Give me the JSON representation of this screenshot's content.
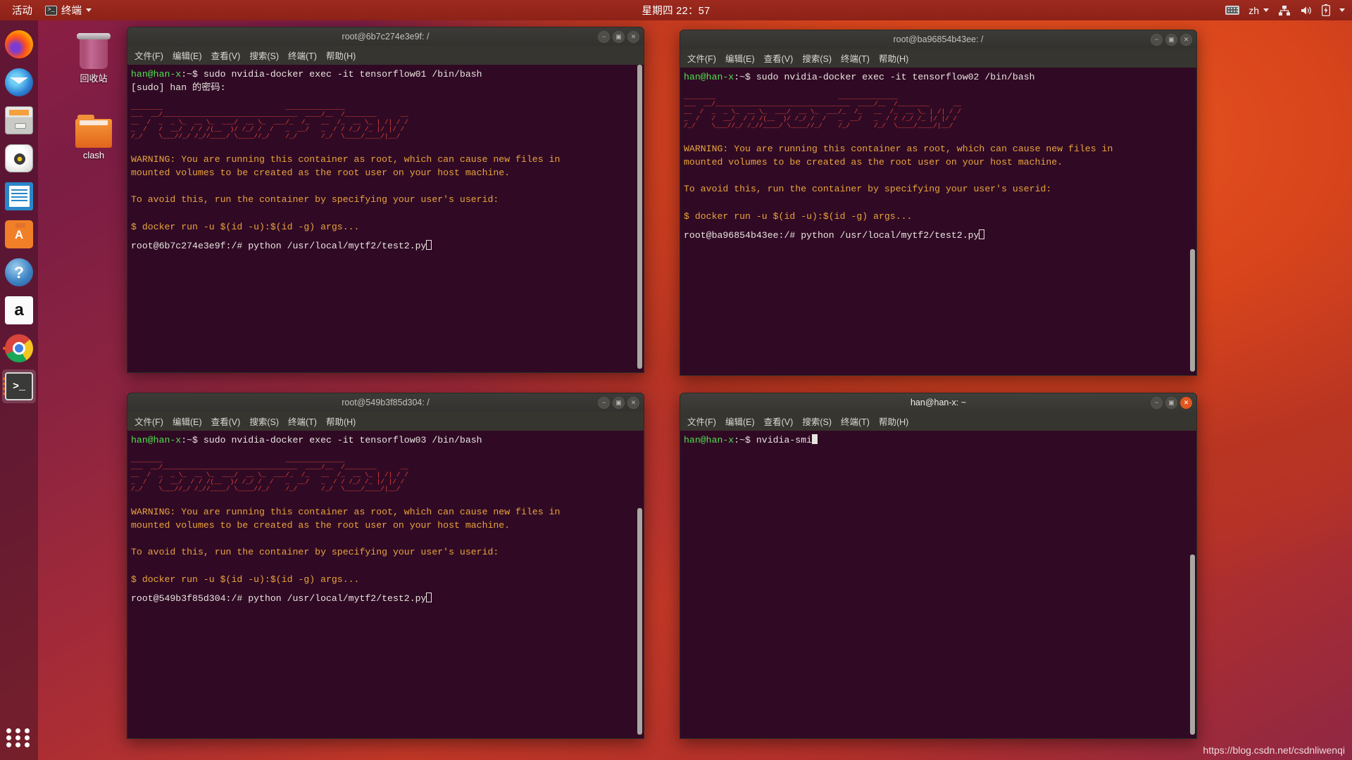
{
  "topbar": {
    "activities": "活动",
    "app_name": "终端",
    "app_icon": "terminal-icon",
    "clock": "星期四 22：57",
    "tray": {
      "keyboard_icon": "keyboard-icon",
      "input_language": "zh",
      "network_icon": "network-icon",
      "volume_icon": "volume-icon",
      "battery_icon": "battery-icon",
      "dropdown_icon": "chevron-down-icon"
    }
  },
  "dock": {
    "items": [
      {
        "name": "firefox",
        "icon": "firefox-icon",
        "glyph": "",
        "running": false
      },
      {
        "name": "thunderbird",
        "icon": "thunderbird-icon",
        "glyph": "",
        "running": false
      },
      {
        "name": "files",
        "icon": "files-icon",
        "glyph": "",
        "running": false
      },
      {
        "name": "rhythmbox",
        "icon": "rhythmbox-icon",
        "glyph": "",
        "running": false
      },
      {
        "name": "libreoffice-writer",
        "icon": "writer-icon",
        "glyph": "",
        "running": false
      },
      {
        "name": "ubuntu-software",
        "icon": "software-icon",
        "glyph": "",
        "running": false
      },
      {
        "name": "help",
        "icon": "help-icon",
        "glyph": "?",
        "running": false
      },
      {
        "name": "amazon",
        "icon": "amazon-icon",
        "glyph": "a",
        "running": false
      },
      {
        "name": "chrome",
        "icon": "chrome-icon",
        "glyph": "",
        "running": true
      },
      {
        "name": "terminal",
        "icon": "terminal-icon",
        "glyph": ">_",
        "running": true
      }
    ],
    "show_apps_label": "显示应用程序"
  },
  "desktop_icons": [
    {
      "label": "回收站",
      "icon": "trash-icon"
    },
    {
      "label": "clash",
      "icon": "folder-icon"
    }
  ],
  "menu": {
    "file": "文件(F)",
    "edit": "编辑(E)",
    "view": "查看(V)",
    "search": "搜索(S)",
    "terminal": "终端(T)",
    "help": "帮助(H)"
  },
  "window_buttons": {
    "minimize": "−",
    "maximize": "▣",
    "close": "✕"
  },
  "ascii_banner": [
    "________                               _______________",
    "___  __/__________________________________  ____/__  /________      __",
    "__  /  _  _ \\_  __ \\_  ___/  __ \\_  ___/_  /_   __  /_  __ \\_ | /| / /",
    "_  /   /  __/  / / /(__  )/ /_/ /  /   _  __/   _  / / /_/ /_ |/ |/ /",
    "/_/    \\___//_/ /_//____/ \\____//_/    /_/      /_/  \\____/____/|__/"
  ],
  "warning_lines": [
    "WARNING: You are running this container as root, which can cause new files in",
    "mounted volumes to be created as the root user on your host machine.",
    "",
    "To avoid this, run the container by specifying your user's userid:",
    "",
    "$ docker run -u $(id -u):$(id -g) args..."
  ],
  "windows": [
    {
      "id": "win-tensorflow01",
      "title": "root@6b7c274e3e9f: /",
      "focused": false,
      "prompt_user": "han@han-x",
      "prompt_path": ":~$ ",
      "command": "sudo nvidia-docker exec -it tensorflow01 /bin/bash",
      "sudo_line": "[sudo] han 的密码:",
      "root_prompt": "root@6b7c274e3e9f:/# ",
      "root_command": "python /usr/local/mytf2/test2.py",
      "show_banner": true
    },
    {
      "id": "win-tensorflow02",
      "title": "root@ba96854b43ee: /",
      "focused": false,
      "prompt_user": "han@han-x",
      "prompt_path": ":~$ ",
      "command": "sudo nvidia-docker exec -it tensorflow02 /bin/bash",
      "sudo_line": "",
      "root_prompt": "root@ba96854b43ee:/# ",
      "root_command": "python /usr/local/mytf2/test2.py",
      "show_banner": true
    },
    {
      "id": "win-tensorflow03",
      "title": "root@549b3f85d304: /",
      "focused": false,
      "prompt_user": "han@han-x",
      "prompt_path": ":~$ ",
      "command": "sudo nvidia-docker exec -it tensorflow03 /bin/bash",
      "sudo_line": "",
      "root_prompt": "root@549b3f85d304:/# ",
      "root_command": "python /usr/local/mytf2/test2.py",
      "show_banner": true
    },
    {
      "id": "win-nvidia-smi",
      "title": "han@han-x: ~",
      "focused": true,
      "prompt_user": "han@han-x",
      "prompt_path": ":~$ ",
      "command": "nvidia-smi",
      "sudo_line": "",
      "root_prompt": "",
      "root_command": "",
      "show_banner": false
    }
  ],
  "watermark": "https://blog.csdn.net/csdnliwenqi",
  "colors": {
    "terminal_bg": "#300a24",
    "accent_orange": "#e2571f",
    "prompt_green": "#4ee24e",
    "warning_yellow": "#e8a33d",
    "banner_red": "#e8453c"
  }
}
